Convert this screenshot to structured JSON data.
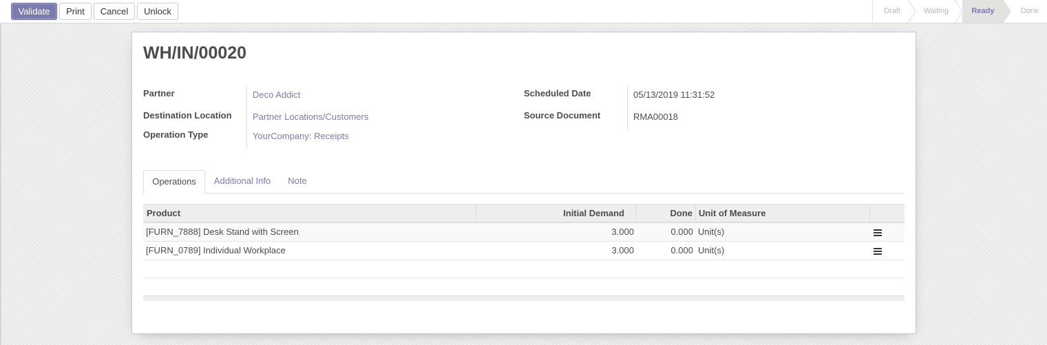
{
  "control_panel": {
    "buttons": {
      "validate": "Validate",
      "print": "Print",
      "cancel": "Cancel",
      "unlock": "Unlock"
    },
    "stages": [
      {
        "label": "Draft",
        "active": false
      },
      {
        "label": "Waiting",
        "active": false
      },
      {
        "label": "Ready",
        "active": true
      },
      {
        "label": "Done",
        "active": false
      }
    ]
  },
  "record": {
    "name": "WH/IN/00020",
    "fields_left": [
      {
        "label": "Partner",
        "value": "Deco Addict",
        "is_link": true
      },
      {
        "label": "Destination Location",
        "value": "Partner Locations/Customers",
        "is_link": true
      },
      {
        "label": "Operation Type",
        "value": "YourCompany: Receipts",
        "is_link": true
      }
    ],
    "fields_right": [
      {
        "label": "Scheduled Date",
        "value": "05/13/2019 11:31:52",
        "is_link": false
      },
      {
        "label": "Source Document",
        "value": "RMA00018",
        "is_link": false
      }
    ]
  },
  "tabs": [
    {
      "label": "Operations",
      "active": true
    },
    {
      "label": "Additional Info",
      "active": false
    },
    {
      "label": "Note",
      "active": false
    }
  ],
  "operations_table": {
    "columns": [
      "Product",
      "Initial Demand",
      "Done",
      "Unit of Measure",
      ""
    ],
    "rows": [
      {
        "product": "[FURN_7888] Desk Stand with Screen",
        "initial_demand": "3.000",
        "done": "0.000",
        "uom": "Unit(s)",
        "icon": "list-icon"
      },
      {
        "product": "[FURN_0789] Individual Workplace",
        "initial_demand": "3.000",
        "done": "0.000",
        "uom": "Unit(s)",
        "icon": "list-icon"
      }
    ]
  },
  "colors": {
    "primary": "#7c7bad",
    "link": "#7c7bad",
    "active_stage_bg": "#e2e2e0"
  }
}
